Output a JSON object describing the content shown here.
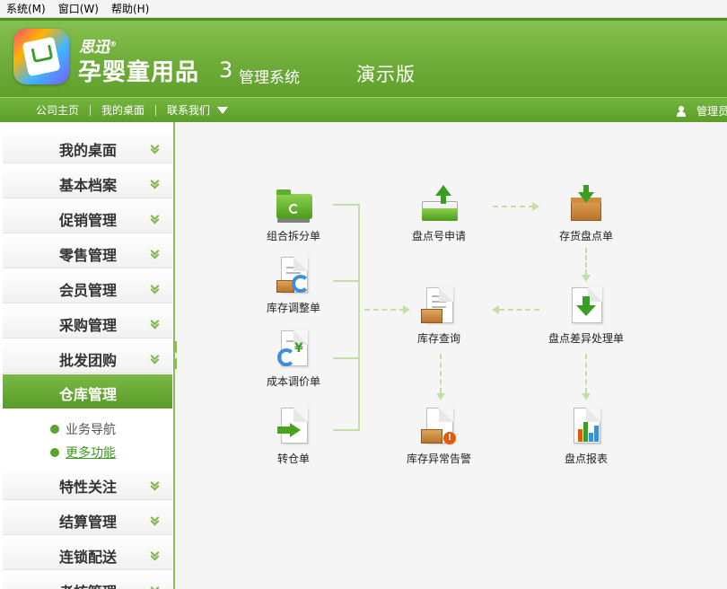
{
  "menubar": {
    "items": [
      "系统(M)",
      "窗口(W)",
      "帮助(H)"
    ]
  },
  "header": {
    "brand_small": "思迅",
    "brand_reg": "®",
    "product_name": "孕婴童用品",
    "version": "3",
    "system_label": "管理系统",
    "edition": "演示版"
  },
  "nav": {
    "links": [
      "公司主页",
      "我的桌面",
      "联系我们"
    ],
    "user": "管理员"
  },
  "sidebar": {
    "items": [
      "我的桌面",
      "基本档案",
      "促销管理",
      "零售管理",
      "会员管理",
      "采购管理",
      "批发团购"
    ],
    "active": "仓库管理",
    "sub_items": [
      "业务导航",
      "更多功能"
    ],
    "items_after": [
      "特性关注",
      "结算管理",
      "连锁配送",
      "考核管理"
    ]
  },
  "flow": {
    "nodes": {
      "combo_split": "组合拆分单",
      "inventory_adjust": "库存调整单",
      "cost_adjust": "成本调价单",
      "transfer": "转仓单",
      "count_apply": "盘点号申请",
      "inventory_query": "库存查询",
      "stock_alert": "库存异常告警",
      "stock_count": "存货盘点单",
      "count_diff": "盘点差异处理单",
      "count_report": "盘点报表"
    }
  },
  "colors": {
    "brand_green": "#6fad3a",
    "accent_green": "#5aa62b",
    "flow_line": "#c2e0a4"
  }
}
